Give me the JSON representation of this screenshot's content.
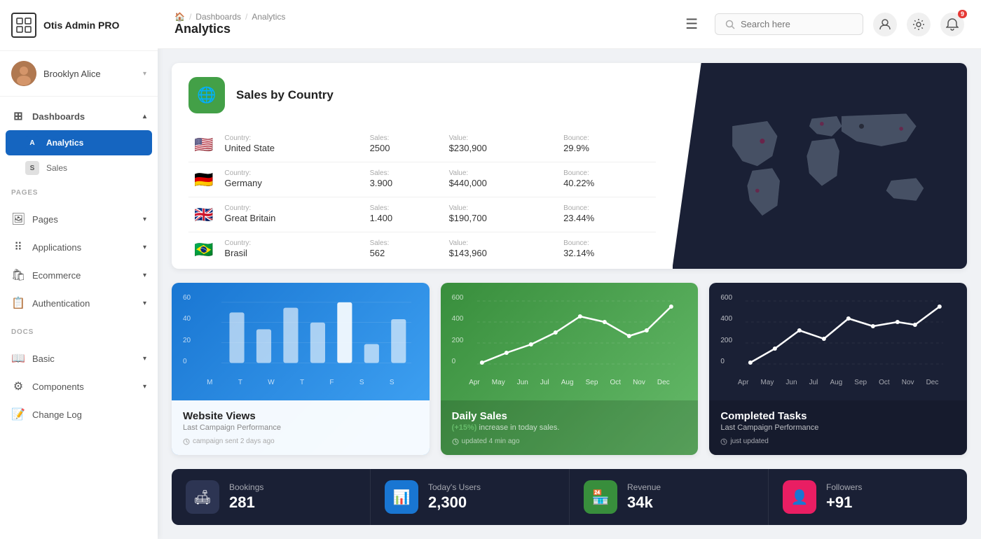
{
  "app": {
    "name": "Otis Admin PRO"
  },
  "user": {
    "name": "Brooklyn Alice"
  },
  "sidebar": {
    "sections": [
      {
        "items": [
          {
            "id": "dashboards",
            "label": "Dashboards",
            "icon": "⊞",
            "active": false,
            "expanded": true,
            "children": [
              {
                "id": "analytics",
                "label": "Analytics",
                "letter": "A",
                "active": true
              },
              {
                "id": "sales",
                "label": "Sales",
                "letter": "S",
                "active": false
              }
            ]
          }
        ]
      }
    ],
    "pages_label": "PAGES",
    "pages": [
      {
        "id": "pages",
        "label": "Pages",
        "icon": "🖼"
      },
      {
        "id": "applications",
        "label": "Applications",
        "icon": "⠿"
      },
      {
        "id": "ecommerce",
        "label": "Ecommerce",
        "icon": "🛍"
      },
      {
        "id": "authentication",
        "label": "Authentication",
        "icon": "📋"
      }
    ],
    "docs_label": "DOCS",
    "docs": [
      {
        "id": "basic",
        "label": "Basic",
        "icon": "📖"
      },
      {
        "id": "components",
        "label": "Components",
        "icon": "⚙"
      },
      {
        "id": "changelog",
        "label": "Change Log",
        "icon": "📝"
      }
    ]
  },
  "header": {
    "menu_icon": "☰",
    "breadcrumb": [
      "🏠",
      "Dashboards",
      "Analytics"
    ],
    "page_title": "Analytics",
    "search_placeholder": "Search here",
    "notification_count": "9"
  },
  "sales_country": {
    "card_title": "Sales by Country",
    "countries": [
      {
        "flag": "🇺🇸",
        "country_label": "Country:",
        "country": "United State",
        "sales_label": "Sales:",
        "sales": "2500",
        "value_label": "Value:",
        "value": "$230,900",
        "bounce_label": "Bounce:",
        "bounce": "29.9%"
      },
      {
        "flag": "🇩🇪",
        "country_label": "Country:",
        "country": "Germany",
        "sales_label": "Sales:",
        "sales": "3.900",
        "value_label": "Value:",
        "value": "$440,000",
        "bounce_label": "Bounce:",
        "bounce": "40.22%"
      },
      {
        "flag": "🇬🇧",
        "country_label": "Country:",
        "country": "Great Britain",
        "sales_label": "Sales:",
        "sales": "1.400",
        "value_label": "Value:",
        "value": "$190,700",
        "bounce_label": "Bounce:",
        "bounce": "23.44%"
      },
      {
        "flag": "🇧🇷",
        "country_label": "Country:",
        "country": "Brasil",
        "sales_label": "Sales:",
        "sales": "562",
        "value_label": "Value:",
        "value": "$143,960",
        "bounce_label": "Bounce:",
        "bounce": "32.14%"
      }
    ]
  },
  "charts": {
    "website_views": {
      "title": "Website Views",
      "subtitle": "Last Campaign Performance",
      "time_label": "campaign sent 2 days ago",
      "y_labels": [
        "60",
        "40",
        "20",
        "0"
      ],
      "x_labels": [
        "M",
        "T",
        "W",
        "T",
        "F",
        "S",
        "S"
      ],
      "bars": [
        45,
        30,
        55,
        38,
        60,
        15,
        42
      ]
    },
    "daily_sales": {
      "title": "Daily Sales",
      "subtitle_prefix": "(+15%)",
      "subtitle_text": " increase in today sales.",
      "time_label": "updated 4 min ago",
      "y_labels": [
        "600",
        "400",
        "200",
        "0"
      ],
      "x_labels": [
        "Apr",
        "May",
        "Jun",
        "Jul",
        "Aug",
        "Sep",
        "Oct",
        "Nov",
        "Dec"
      ],
      "points": [
        10,
        80,
        150,
        250,
        380,
        320,
        200,
        250,
        480
      ]
    },
    "completed_tasks": {
      "title": "Completed Tasks",
      "subtitle": "Last Campaign Performance",
      "time_label": "just updated",
      "y_labels": [
        "600",
        "400",
        "200",
        "0"
      ],
      "x_labels": [
        "Apr",
        "May",
        "Jun",
        "Jul",
        "Aug",
        "Sep",
        "Oct",
        "Nov",
        "Dec"
      ],
      "points": [
        20,
        100,
        250,
        180,
        350,
        280,
        320,
        300,
        480
      ]
    }
  },
  "stats": [
    {
      "id": "bookings",
      "icon": "🛋",
      "icon_style": "dark-gray",
      "label": "Bookings",
      "value": "281"
    },
    {
      "id": "today_users",
      "icon": "📊",
      "icon_style": "blue",
      "label": "Today's Users",
      "value": "2,300"
    },
    {
      "id": "revenue",
      "icon": "🏪",
      "icon_style": "green",
      "label": "Revenue",
      "value": "34k"
    },
    {
      "id": "followers",
      "icon": "👤",
      "icon_style": "pink",
      "label": "Followers",
      "value": "+91"
    }
  ]
}
